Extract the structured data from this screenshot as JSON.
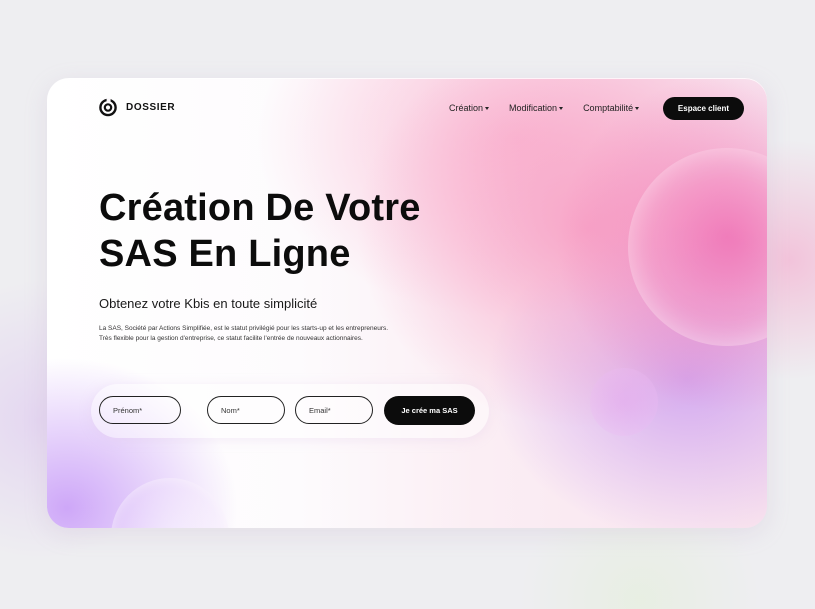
{
  "brand": {
    "name": "DOSSIER",
    "logo_icon": "ring-logo-icon"
  },
  "nav": {
    "items": [
      {
        "label": "Création",
        "icon": "caret-down-icon"
      },
      {
        "label": "Modification",
        "icon": "caret-down-icon"
      },
      {
        "label": "Comptabilité",
        "icon": "caret-down-icon"
      }
    ],
    "client_button": "Espace client"
  },
  "hero": {
    "title_line1": "Création De Votre",
    "title_line2": "SAS En Ligne",
    "subtitle": "Obtenez votre Kbis en toute simplicité",
    "description_line1": "La SAS, Société par Actions Simplifiée, est le statut privilégié pour les starts-up et les entrepreneurs.",
    "description_line2": "Très flexible pour la gestion d'entreprise, ce statut facilite l'entrée de nouveaux actionnaires."
  },
  "form": {
    "first_name_placeholder": "Prénom*",
    "last_name_placeholder": "Nom*",
    "email_placeholder": "Email*",
    "submit_label": "Je crée ma SAS"
  },
  "colors": {
    "primary": "#0c0c0c",
    "accent_pink": "#ee6fae",
    "accent_violet": "#b882f3"
  }
}
